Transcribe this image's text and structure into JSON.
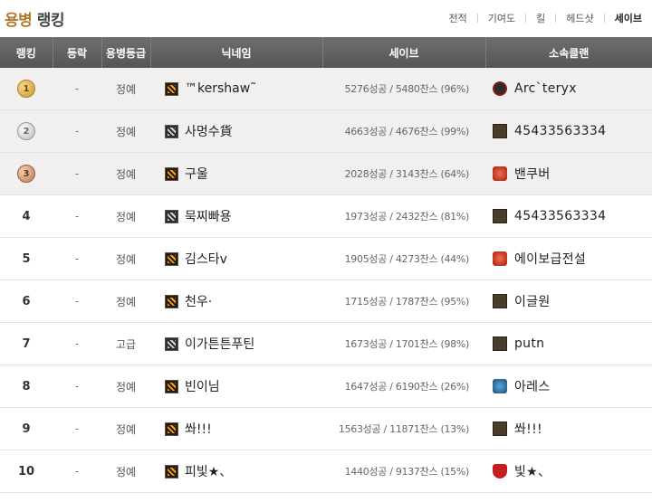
{
  "header": {
    "title_part1": "용병",
    "title_part2": "랭킹",
    "tabs": [
      "전적",
      "기여도",
      "킬",
      "헤드샷",
      "세이브"
    ],
    "active_tab": "세이브"
  },
  "columns": {
    "rank": "랭킹",
    "change": "등락",
    "grade": "용병등급",
    "nickname": "닉네임",
    "save": "세이브",
    "clan": "소속클랜"
  },
  "rows": [
    {
      "rank": "1",
      "medal": "gold",
      "change": "-",
      "grade": "정예",
      "grade_icon": "gold-grade-icon",
      "nickname": "™kershaw˜",
      "save": "5276성공 / 5480찬스 (96%)",
      "clan_icon": "dark",
      "clan": "Arc`teryx"
    },
    {
      "rank": "2",
      "medal": "silver",
      "change": "-",
      "grade": "정예",
      "grade_icon": "gray-grade-icon",
      "nickname": "사멍수貨",
      "save": "4663성공 / 4676찬스 (99%)",
      "clan_icon": "board",
      "clan": "45433563334"
    },
    {
      "rank": "3",
      "medal": "bronze",
      "change": "-",
      "grade": "정예",
      "grade_icon": "gold-grade-icon",
      "nickname": "구울",
      "save": "2028성공 / 3143찬스 (64%)",
      "clan_icon": "red",
      "clan": "밴쿠버"
    },
    {
      "rank": "4",
      "medal": "",
      "change": "-",
      "grade": "정예",
      "grade_icon": "gray-grade-icon",
      "nickname": "묵찌빠용",
      "save": "1973성공 / 2432찬스 (81%)",
      "clan_icon": "board",
      "clan": "45433563334"
    },
    {
      "rank": "5",
      "medal": "",
      "change": "-",
      "grade": "정예",
      "grade_icon": "gold-grade-icon",
      "nickname": "김스타v",
      "save": "1905성공 / 4273찬스 (44%)",
      "clan_icon": "red",
      "clan": "에이보급전설"
    },
    {
      "rank": "6",
      "medal": "",
      "change": "-",
      "grade": "정예",
      "grade_icon": "gold-grade-icon",
      "nickname": "천우·",
      "save": "1715성공 / 1787찬스 (95%)",
      "clan_icon": "board",
      "clan": "이글원"
    },
    {
      "rank": "7",
      "medal": "",
      "change": "-",
      "grade": "고급",
      "grade_icon": "gray-grade-icon",
      "nickname": "이가튼튼푸틴",
      "save": "1673성공 / 1701찬스 (98%)",
      "clan_icon": "board",
      "clan": "putn"
    },
    {
      "rank": "8",
      "medal": "",
      "change": "-",
      "grade": "정예",
      "grade_icon": "gold-grade-icon",
      "nickname": "빈이님",
      "save": "1647성공 / 6190찬스 (26%)",
      "clan_icon": "blue",
      "clan": "아레스"
    },
    {
      "rank": "9",
      "medal": "",
      "change": "-",
      "grade": "정예",
      "grade_icon": "gold-grade-icon",
      "nickname": "쏴!!!",
      "save": "1563성공 / 11871찬스 (13%)",
      "clan_icon": "board",
      "clan": "쏴!!!"
    },
    {
      "rank": "10",
      "medal": "",
      "change": "-",
      "grade": "정예",
      "grade_icon": "gold-grade-icon",
      "nickname": "피빛★、",
      "save": "1440성공 / 9137찬스 (15%)",
      "clan_icon": "shield",
      "clan": "빛★、"
    }
  ]
}
